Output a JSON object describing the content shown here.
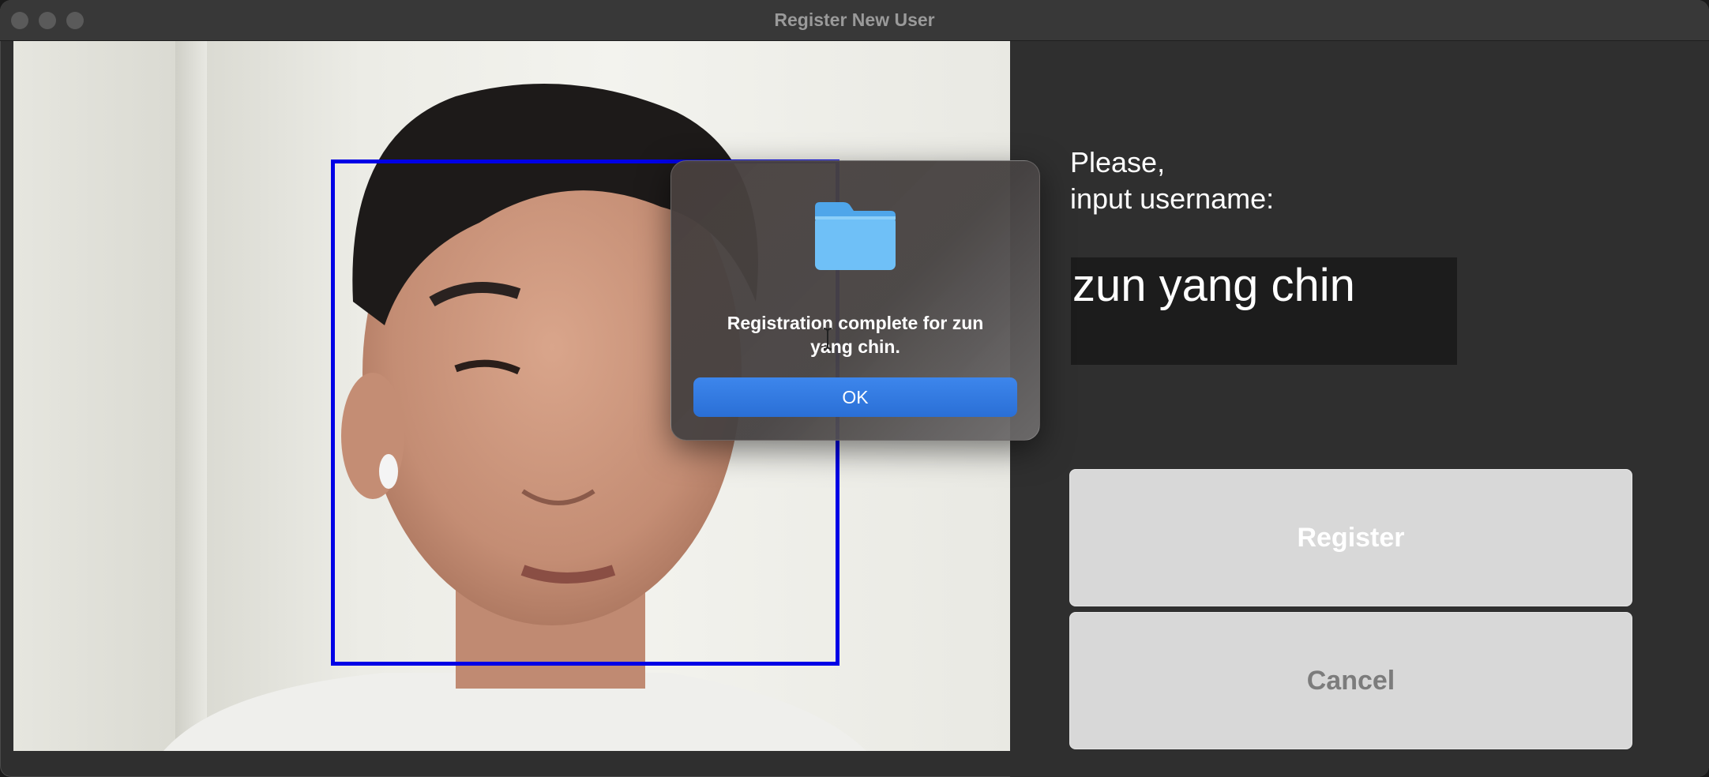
{
  "window": {
    "title": "Register New User"
  },
  "camera": {
    "face_detected": true,
    "box_color": "#0000e6"
  },
  "prompt": {
    "line1": "Please,",
    "line2": "input username:"
  },
  "username_field": {
    "value": "zun yang chin"
  },
  "buttons": {
    "register": "Register",
    "cancel": "Cancel"
  },
  "dialog": {
    "icon": "folder-icon",
    "message_line1": "Registration complete for zun",
    "message_line2": "yang chin.",
    "ok_label": "OK"
  },
  "colors": {
    "accent": "#2f76e0",
    "background": "#2f2f2f"
  }
}
